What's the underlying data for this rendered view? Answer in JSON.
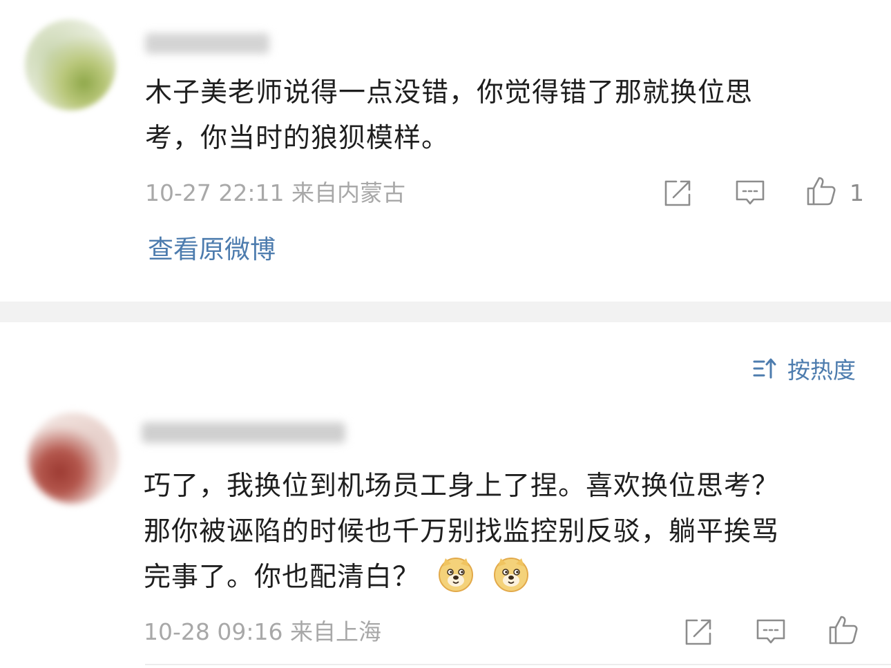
{
  "comments": [
    {
      "text_line1": "木子美老师说得一点没错，你觉得错了那就换位思",
      "text_line2": "考，你当时的狼狈模样。",
      "meta": "10-27 22:11 来自内蒙古",
      "like_count": "1",
      "view_original": "查看原微博"
    },
    {
      "text_line1": "巧了，我换位到机场员工身上了捏。喜欢换位思考？",
      "text_line2": "那你被诬陷的时候也千万别找监控别反驳，躺平挨骂",
      "text_line3": "完事了。你也配清白？",
      "meta": "10-28 09:16 来自上海",
      "emoji_count": 2
    }
  ],
  "sort": {
    "label": "按热度"
  },
  "icons": {
    "share": "share-icon",
    "comment": "comment-icon",
    "like": "thumbs-up-icon",
    "sort": "sort-icon",
    "emoji": "doge-emoji-icon"
  },
  "colors": {
    "link_blue": "#4d7cae",
    "meta_gray": "#a8a8a8",
    "icon_gray": "#8c8c8c",
    "divider": "#f2f2f2"
  }
}
